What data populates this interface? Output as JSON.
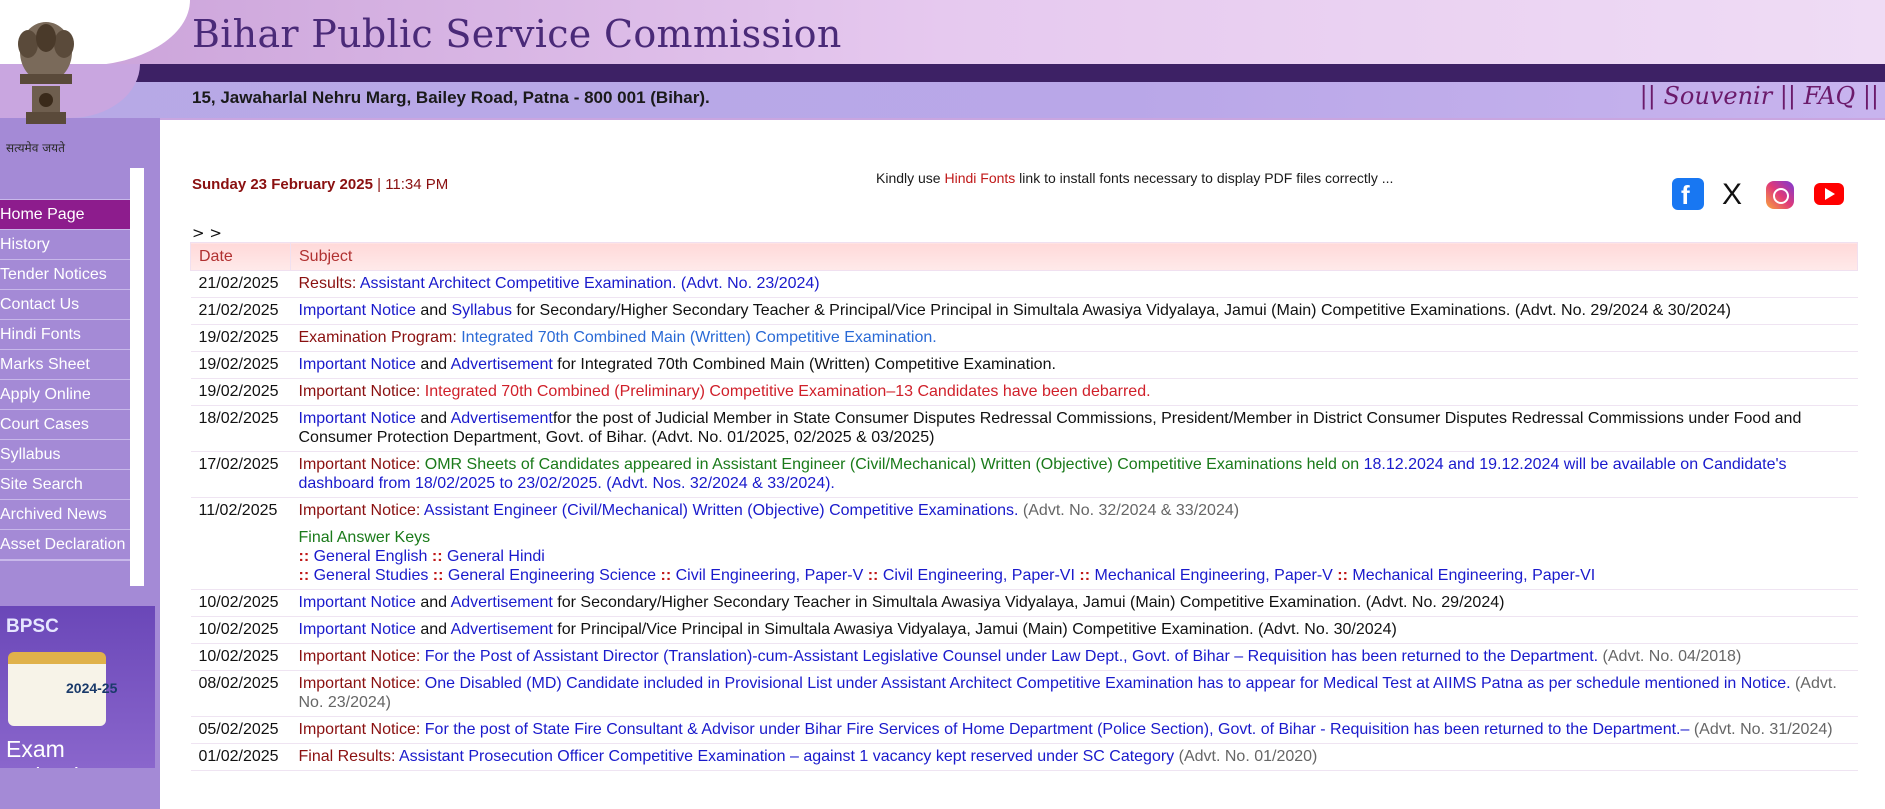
{
  "header": {
    "title": "Bihar Public Service Commission",
    "address": "15, Jawaharlal Nehru Marg, Bailey Road, Patna - 800 001 (Bihar).",
    "links": [
      "Souvenir",
      "FAQ"
    ],
    "emblem_caption": "सत्यमेव जयते"
  },
  "sidebar": {
    "items": [
      {
        "label": "Home Page",
        "active": true
      },
      {
        "label": "History"
      },
      {
        "label": "Tender Notices"
      },
      {
        "label": "Contact Us"
      },
      {
        "label": "Hindi Fonts"
      },
      {
        "label": "Marks Sheet"
      },
      {
        "label": "Apply Online"
      },
      {
        "label": "Court Cases"
      },
      {
        "label": "Syllabus"
      },
      {
        "label": "Site Search"
      },
      {
        "label": "Archived News"
      },
      {
        "label": "Asset Declaration"
      }
    ],
    "calendar": {
      "badge": "BPSC",
      "year": "2024-25",
      "title": "Exam Calendar"
    }
  },
  "main": {
    "date": "Sunday 23 February 2025",
    "separator": "|",
    "time": "11:34 PM",
    "font_notice": {
      "prefix": "Kindly use ",
      "link": "Hindi Fonts",
      "suffix": " link to install fonts necessary to display PDF files correctly ..."
    },
    "breadcrumb": "> >",
    "socials": [
      "facebook-icon",
      "x-icon",
      "instagram-icon",
      "youtube-icon"
    ],
    "table": {
      "headers": [
        "Date",
        "Subject"
      ],
      "rows": [
        {
          "date": "21/02/2025",
          "parts": [
            [
              "Results: ",
              "dred"
            ],
            [
              "Assistant Architect Competitive Examination. (Advt. No. 23/2024)",
              "blue"
            ]
          ]
        },
        {
          "date": "21/02/2025",
          "parts": [
            [
              "Important Notice",
              "blue"
            ],
            [
              " and ",
              ""
            ],
            [
              "Syllabus",
              "blue"
            ],
            [
              " for Secondary/Higher Secondary Teacher & Principal/Vice Principal in Simultala Awasiya Vidyalaya, Jamui (Main) Competitive Examinations. (Advt. No. 29/2024 & 30/2024)",
              ""
            ]
          ]
        },
        {
          "date": "19/02/2025",
          "parts": [
            [
              "Examination Program: ",
              "dred"
            ],
            [
              "Integrated 70th Combined Main (Written) Competitive Examination.",
              "mblue"
            ]
          ]
        },
        {
          "date": "19/02/2025",
          "parts": [
            [
              "Important Notice",
              "blue"
            ],
            [
              " and ",
              ""
            ],
            [
              "Advertisement",
              "blue"
            ],
            [
              " for Integrated 70th Combined Main (Written) Competitive Examination.",
              ""
            ]
          ]
        },
        {
          "date": "19/02/2025",
          "parts": [
            [
              "Important Notice: ",
              "dred"
            ],
            [
              "Integrated 70th Combined (Preliminary) Competitive Examination–13 Candidates have been debarred.",
              "red"
            ]
          ]
        },
        {
          "date": "18/02/2025",
          "parts": [
            [
              "Important Notice",
              "blue"
            ],
            [
              " and ",
              ""
            ],
            [
              "Advertisement",
              "blue"
            ],
            [
              "for the post of Judicial Member in State Consumer Disputes Redressal Commissions, President/Member in District Consumer Disputes Redressal Commissions under Food and Consumer Protection Department, Govt. of Bihar. (Advt. No. 01/2025, 02/2025 & 03/2025)",
              ""
            ]
          ]
        },
        {
          "date": "17/02/2025",
          "parts": [
            [
              "Important Notice: ",
              "dred"
            ],
            [
              "OMR Sheets of Candidates appeared in Assistant Engineer (Civil/Mechanical) Written (Objective) Competitive Examinations held on ",
              "green"
            ],
            [
              "18.12.2024 and 19.12.2024 will be available on Candidate's dashboard from 18/02/2025 to 23/02/2025. (Advt. Nos. 32/2024 & 33/2024).",
              "blue"
            ]
          ]
        },
        {
          "date": "11/02/2025",
          "parts": [
            [
              "Important Notice: ",
              "dred"
            ],
            [
              "Assistant Engineer (Civil/Mechanical) Written (Objective) Competitive Examinations.",
              "blue"
            ],
            [
              " (Advt. No. 32/2024 & 33/2024)",
              "gray"
            ]
          ],
          "extra": {
            "heading": "Final Answer Keys",
            "line1": [
              "General English",
              "General Hindi"
            ],
            "line2": [
              "General Studies",
              "General Engineering Science",
              "Civil Engineering, Paper-V",
              "Civil Engineering, Paper-VI",
              "Mechanical Engineering, Paper-V",
              "Mechanical Engineering, Paper-VI"
            ],
            "sep": "::"
          }
        },
        {
          "date": "10/02/2025",
          "parts": [
            [
              "Important Notice",
              "blue"
            ],
            [
              " and ",
              ""
            ],
            [
              "Advertisement",
              "blue"
            ],
            [
              " for Secondary/Higher Secondary Teacher in Simultala Awasiya Vidyalaya, Jamui (Main) Competitive Examination. (Advt. No. 29/2024)",
              ""
            ]
          ]
        },
        {
          "date": "10/02/2025",
          "parts": [
            [
              "Important Notice",
              "blue"
            ],
            [
              " and ",
              ""
            ],
            [
              "Advertisement",
              "blue"
            ],
            [
              " for Principal/Vice Principal in Simultala Awasiya Vidyalaya, Jamui (Main) Competitive Examination. (Advt. No. 30/2024)",
              ""
            ]
          ]
        },
        {
          "date": "10/02/2025",
          "parts": [
            [
              "Important Notice: ",
              "dred"
            ],
            [
              "For the Post of Assistant Director (Translation)-cum-Assistant Legislative Counsel under Law Dept., Govt. of Bihar – Requisition has been returned to the Department.",
              "blue"
            ],
            [
              " (Advt. No. 04/2018)",
              "gray"
            ]
          ]
        },
        {
          "date": "08/02/2025",
          "parts": [
            [
              "Important Notice: ",
              "dred"
            ],
            [
              "One Disabled (MD) Candidate included in Provisional List under Assistant Architect Competitive Examination has to appear for Medical Test at AIIMS Patna as per schedule mentioned in Notice.",
              "blue"
            ],
            [
              " (Advt. No. 23/2024)",
              "gray"
            ]
          ]
        },
        {
          "date": "05/02/2025",
          "parts": [
            [
              "Important Notice: ",
              "dred"
            ],
            [
              "For the post of State Fire Consultant & Advisor under Bihar Fire Services of Home Department (Police Section), Govt. of Bihar - Requisition has been returned to the Department.–",
              "blue"
            ],
            [
              " (Advt. No. 31/2024)",
              "gray"
            ]
          ]
        },
        {
          "date": "01/02/2025",
          "parts": [
            [
              "Final Results: ",
              "dred"
            ],
            [
              "Assistant Prosecution Officer Competitive Examination – against 1 vacancy kept reserved under SC Category",
              "blue"
            ],
            [
              " (Advt. No. 01/2020)",
              "gray"
            ]
          ]
        }
      ]
    }
  },
  "colors": {
    "brand_purple": "#3d2165",
    "nav_active": "#8d1c8d",
    "nav_bg": "#a48ad6",
    "link_blue": "#1a1acc",
    "accent_red": "#c01818"
  }
}
